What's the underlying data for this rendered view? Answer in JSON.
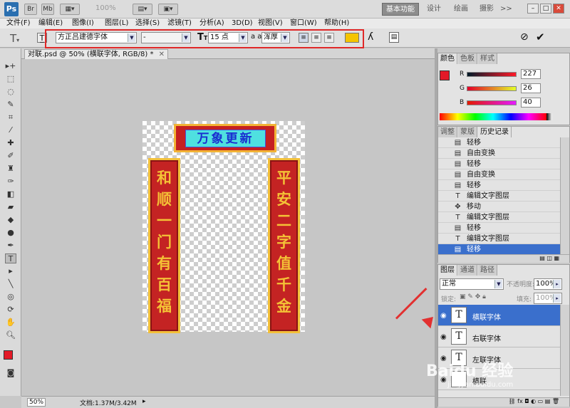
{
  "titlebar": {
    "logo": "Ps",
    "br": "Br",
    "mb": "Mb",
    "zoom": "100%",
    "workspaces": [
      "基本功能",
      "设计",
      "绘画",
      "摄影"
    ],
    "more": ">>"
  },
  "menu": [
    "文件(F)",
    "编辑(E)",
    "图像(I)",
    "图层(L)",
    "选择(S)",
    "滤镜(T)",
    "分析(A)",
    "3D(D)",
    "视图(V)",
    "窗口(W)",
    "帮助(H)"
  ],
  "options": {
    "font_family": "方正吕建德字体",
    "font_style": "-",
    "font_size": "15 点",
    "aa_label": "a a",
    "antialias": "浑厚",
    "text_color": "#f5c400"
  },
  "document": {
    "tab_title": "对联.psd @ 50% (横联字体, RGB/8) *",
    "head_text": "万象更新",
    "left_text": "和顺一门有百福",
    "right_text": "平安二字值千金"
  },
  "status": {
    "zoom": "50%",
    "doc_info": "文档:1.37M/3.42M"
  },
  "color_panel": {
    "tabs": [
      "颜色",
      "色板",
      "样式"
    ],
    "r_label": "R",
    "g_label": "G",
    "b_label": "B",
    "r": "227",
    "g": "26",
    "b": "40",
    "fg_color": "#e31a28"
  },
  "history_panel": {
    "tabs": [
      "调整",
      "蒙版",
      "历史记录"
    ],
    "items": [
      {
        "icon": "doc-icon",
        "glyph": "▤",
        "label": "轻移"
      },
      {
        "icon": "doc-icon",
        "glyph": "▤",
        "label": "自由变换"
      },
      {
        "icon": "doc-icon",
        "glyph": "▤",
        "label": "轻移"
      },
      {
        "icon": "doc-icon",
        "glyph": "▤",
        "label": "自由变换"
      },
      {
        "icon": "doc-icon",
        "glyph": "▤",
        "label": "轻移"
      },
      {
        "icon": "text-icon",
        "glyph": "T",
        "label": "编辑文字图层"
      },
      {
        "icon": "move-icon",
        "glyph": "✥",
        "label": "移动"
      },
      {
        "icon": "text-icon",
        "glyph": "T",
        "label": "编辑文字图层"
      },
      {
        "icon": "doc-icon",
        "glyph": "▤",
        "label": "轻移"
      },
      {
        "icon": "text-icon",
        "glyph": "T",
        "label": "编辑文字图层"
      },
      {
        "icon": "doc-icon",
        "glyph": "▤",
        "label": "轻移"
      }
    ]
  },
  "layers_panel": {
    "tabs": [
      "图层",
      "通道",
      "路径"
    ],
    "blend_mode": "正常",
    "opacity_label": "不透明度:",
    "opacity": "100%",
    "lock_label": "锁定:",
    "fill_label": "填充:",
    "fill": "100%",
    "layers": [
      {
        "name": "横联字体",
        "thumb": "T"
      },
      {
        "name": "右联字体",
        "thumb": "T"
      },
      {
        "name": "左联字体",
        "thumb": "T"
      },
      {
        "name": "横联",
        "thumb": ""
      }
    ]
  },
  "watermark": "Baidu 经验",
  "watermark_url": "jingyan.baidu.com"
}
